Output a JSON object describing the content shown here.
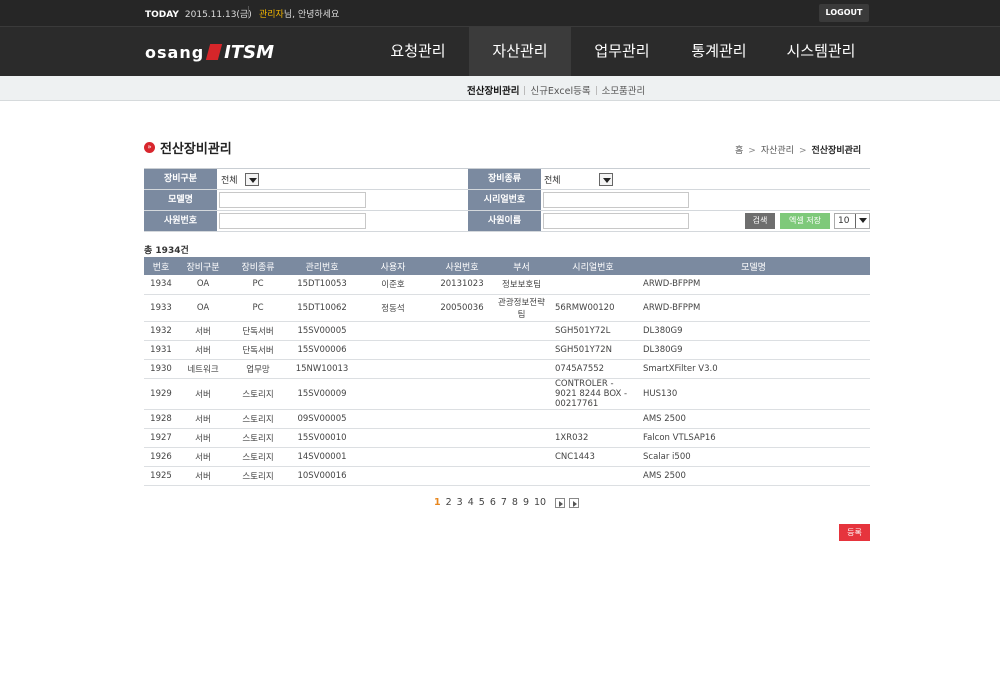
{
  "topbar": {
    "today_label": "TODAY",
    "today_value": "2015.11.13(금)",
    "user_name": "관리자",
    "greeting": "님, 안녕하세요",
    "logout_label": "LOGOUT"
  },
  "logo": {
    "brand": "osang",
    "product": "ITSM"
  },
  "menu": [
    {
      "label": "요청관리"
    },
    {
      "label": "자산관리"
    },
    {
      "label": "업무관리"
    },
    {
      "label": "통계관리"
    },
    {
      "label": "시스템관리"
    }
  ],
  "submenu": [
    {
      "label": "전산장비관리"
    },
    {
      "label": "신규Excel등록"
    },
    {
      "label": "소모품관리"
    }
  ],
  "page": {
    "title": "전산장비관리",
    "breadcrumb": [
      "홈",
      "자산관리",
      "전산장비관리"
    ]
  },
  "search": {
    "equip_type_label": "장비구분",
    "equip_type_value": "전체",
    "equip_kind_label": "장비종류",
    "equip_kind_value": "전체",
    "model_label": "모델명",
    "serial_label": "시리얼번호",
    "emp_no_label": "사원번호",
    "emp_name_label": "사원이름",
    "search_btn": "검색",
    "excel_btn": "엑셀 저장",
    "page_size": "10"
  },
  "count_text": "총 1934건",
  "table": {
    "headers": [
      "번호",
      "장비구분",
      "장비종류",
      "관리번호",
      "사용자",
      "사원번호",
      "부서",
      "시리얼번호",
      "모델명"
    ],
    "rows": [
      [
        "1934",
        "OA",
        "PC",
        "15DT10053",
        "이준호",
        "20131023",
        "정보보호팀",
        "",
        "ARWD-BFPPM"
      ],
      [
        "1933",
        "OA",
        "PC",
        "15DT10062",
        "정동석",
        "20050036",
        "관광정보전략팀",
        "56RMW00120",
        "ARWD-BFPPM"
      ],
      [
        "1932",
        "서버",
        "단독서버",
        "15SV00005",
        "",
        "",
        "",
        "SGH501Y72L",
        "DL380G9"
      ],
      [
        "1931",
        "서버",
        "단독서버",
        "15SV00006",
        "",
        "",
        "",
        "SGH501Y72N",
        "DL380G9"
      ],
      [
        "1930",
        "네트워크",
        "업무망",
        "15NW10013",
        "",
        "",
        "",
        "0745A7552",
        "SmartXFilter V3.0"
      ],
      [
        "1929",
        "서버",
        "스토리지",
        "15SV00009",
        "",
        "",
        "",
        "CONTROLER - 9021 8244 BOX - 00217761",
        "HUS130"
      ],
      [
        "1928",
        "서버",
        "스토리지",
        "09SV00005",
        "",
        "",
        "",
        "",
        "AMS 2500"
      ],
      [
        "1927",
        "서버",
        "스토리지",
        "15SV00010",
        "",
        "",
        "",
        "1XR032",
        "Falcon VTLSAP16"
      ],
      [
        "1926",
        "서버",
        "스토리지",
        "14SV00001",
        "",
        "",
        "",
        "CNC1443",
        "Scalar i500"
      ],
      [
        "1925",
        "서버",
        "스토리지",
        "10SV00016",
        "",
        "",
        "",
        "",
        "AMS 2500"
      ]
    ]
  },
  "pagination": {
    "pages": [
      "1",
      "2",
      "3",
      "4",
      "5",
      "6",
      "7",
      "8",
      "9",
      "10"
    ],
    "current": "1"
  },
  "register_btn": "등록"
}
